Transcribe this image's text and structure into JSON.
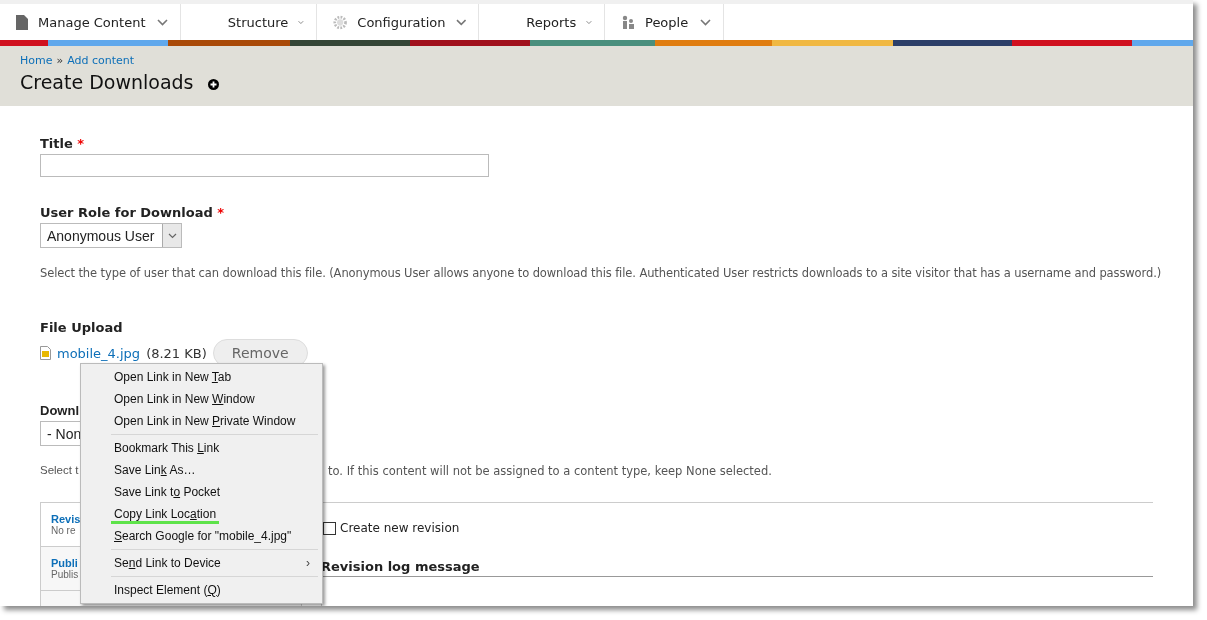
{
  "nav": [
    {
      "label": "Manage Content"
    },
    {
      "label": "Structure"
    },
    {
      "label": "Configuration"
    },
    {
      "label": "Reports"
    },
    {
      "label": "People"
    }
  ],
  "breadcrumb": [
    "Home",
    "Add content"
  ],
  "breadcrumb_separator": "»",
  "page_title": "Create Downloads",
  "title_field": {
    "label": "Title",
    "required_mark": "*"
  },
  "role_field": {
    "label": "User Role for Download",
    "required_mark": "*",
    "value": "Anonymous User",
    "description": "Select the type of user that can download this file. (Anonymous User allows anyone to download this file. Authenticated User restricts downloads to a site visitor that has a username and password.)"
  },
  "file_upload": {
    "label": "File Upload",
    "file_name": "mobile_4.jpg",
    "size": "(8.21 KB)",
    "remove_button": "Remove"
  },
  "download_field": {
    "label": "Downl",
    "value": "- Non",
    "description_start": "Select t",
    "description_end": "to. If this content will not be assigned to a content type, keep None selected."
  },
  "vertical_tabs": [
    {
      "title": "Revis",
      "summary": "No re"
    },
    {
      "title": "Publi",
      "summary": "Publis"
    }
  ],
  "revision": {
    "checkbox_label": "Create new revision",
    "checked": false,
    "log_label": "Revision log message"
  },
  "context_menu": [
    [
      {
        "before": "Open Link in New ",
        "key": "T",
        "after": "ab",
        "highlighted": false
      },
      {
        "before": "Open Link in New ",
        "key": "W",
        "after": "indow",
        "highlighted": false
      },
      {
        "before": "Open Link in New ",
        "key": "P",
        "after": "rivate Window",
        "highlighted": false
      }
    ],
    [
      {
        "before": "Bookmark This ",
        "key": "L",
        "after": "ink",
        "highlighted": false
      },
      {
        "before": "Save Lin",
        "key": "k",
        "after": " As…",
        "highlighted": false
      },
      {
        "before": "Save Link t",
        "key": "o",
        "after": " Pocket",
        "highlighted": false
      },
      {
        "before": "Copy Link Loc",
        "key": "a",
        "after": "tion",
        "highlighted": true
      },
      {
        "key": "S",
        "after": "earch Google for \"mobile_4.jpg\"",
        "highlighted": false
      }
    ],
    [
      {
        "before": "Se",
        "key": "n",
        "after": "d Link to Device",
        "submenu": "›",
        "highlighted": false
      }
    ],
    [
      {
        "before": "Inspect Element (",
        "key": "Q",
        "after": ")",
        "highlighted": false
      }
    ]
  ]
}
